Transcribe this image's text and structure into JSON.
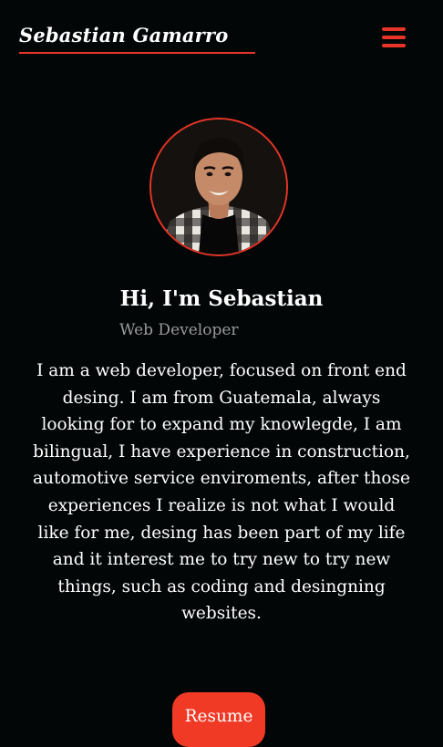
{
  "header": {
    "logo_text": "Sebastian Gamarro",
    "menu_icon": "hamburger-menu-icon",
    "accent_color": "#e63526"
  },
  "profile": {
    "name": "Hi, I'm Sebastian",
    "role": "Web Developer",
    "bio": "I am a web developer, focused on front end desing. I am from Guatemala, always looking for to expand my knowlegde, I am bilingual, I have experience in construction, automotive service enviroments, after those experiences I realize is not what I would like for me, desing has been part of my life and it interest me to try new to try new things, such as coding and desingning websites."
  },
  "actions": {
    "resume_label": "Resume"
  }
}
